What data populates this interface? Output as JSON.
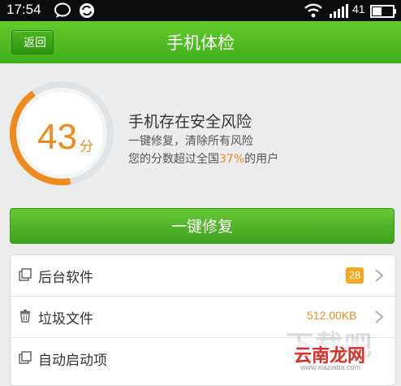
{
  "status_bar": {
    "time": "17:54",
    "battery": "41"
  },
  "header": {
    "back_label": "返回",
    "title": "手机体检"
  },
  "score": {
    "value": "43",
    "unit": "分",
    "level": 0.43,
    "headline": "手机存在安全风险",
    "subline": "一键修复，清除所有风险",
    "compare_prefix": "您的分数超过全国",
    "compare_pct": "37%",
    "compare_suffix": "的用户"
  },
  "fix_button": "一键修复",
  "items": [
    {
      "label": "后台软件",
      "badge": "28"
    },
    {
      "label": "垃圾文件",
      "size": "512.00KB"
    },
    {
      "label": "自动启动项"
    }
  ],
  "watermark": {
    "main": "下载吧",
    "brand": "云南龙网",
    "url": "www.xiazaiba.com"
  },
  "colors": {
    "accent": "#f08a1d",
    "green": "#4cb624",
    "badge": "#f6a81f"
  }
}
